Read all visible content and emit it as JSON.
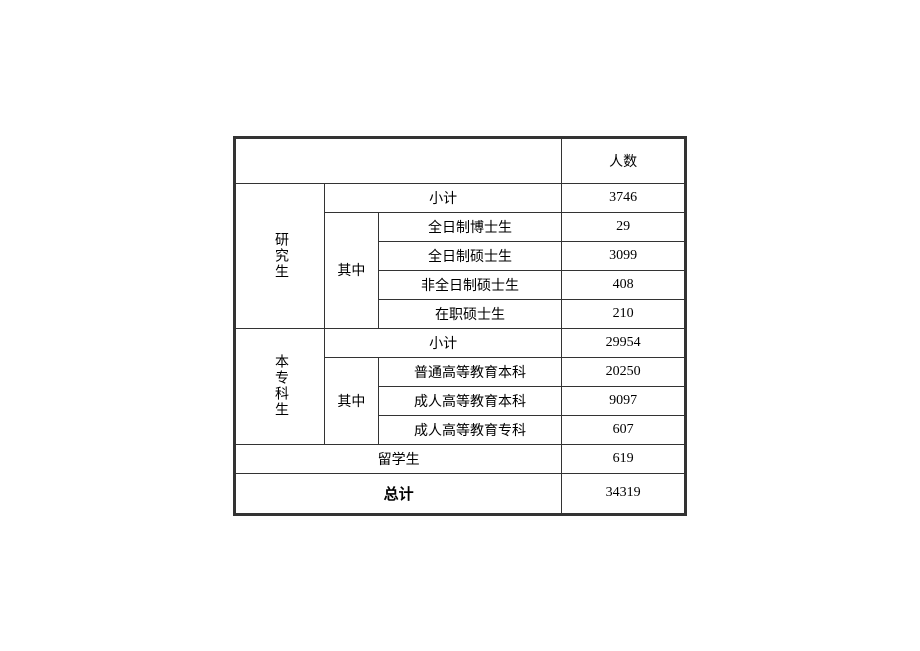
{
  "headers": {
    "count": "人数"
  },
  "sections": {
    "grad": {
      "label": "研究生",
      "subtotal_label": "小计",
      "subtotal_value": "3746",
      "sub_label": "其中",
      "items": [
        {
          "label": "全日制博士生",
          "value": "29"
        },
        {
          "label": "全日制硕士生",
          "value": "3099"
        },
        {
          "label": "非全日制硕士生",
          "value": "408"
        },
        {
          "label": "在职硕士生",
          "value": "210"
        }
      ]
    },
    "undergrad": {
      "label": "本专科生",
      "subtotal_label": "小计",
      "subtotal_value": "29954",
      "sub_label": "其中",
      "items": [
        {
          "label": "普通高等教育本科",
          "value": "20250"
        },
        {
          "label": "成人高等教育本科",
          "value": "9097"
        },
        {
          "label": "成人高等教育专科",
          "value": "607"
        }
      ]
    },
    "intl": {
      "label": "留学生",
      "value": "619"
    },
    "total": {
      "label": "总计",
      "value": "34319"
    }
  }
}
